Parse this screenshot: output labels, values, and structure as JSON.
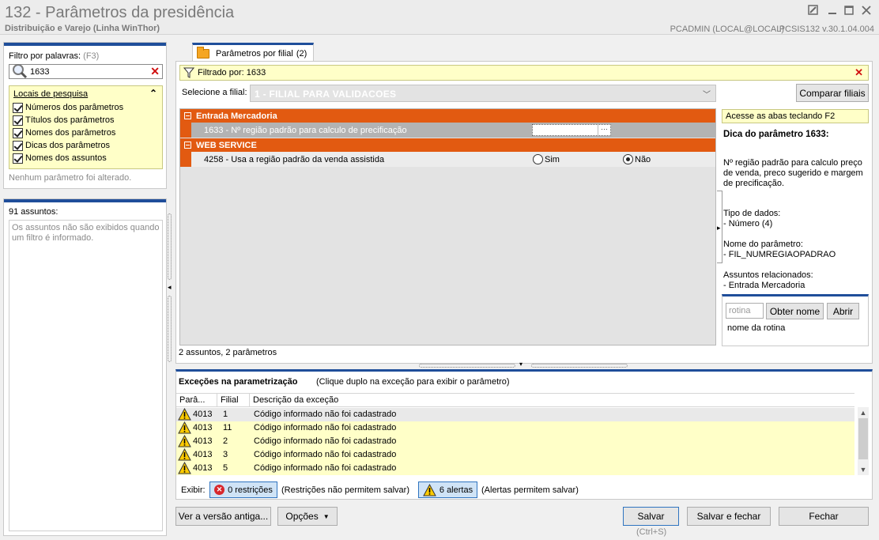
{
  "window": {
    "title": "132 - Parâmetros da presidência",
    "subtitle": "Distribuição e Varejo (Linha WinThor)",
    "user": "PCADMIN (LOCAL@LOCAL)",
    "version": "PCSIS132  v.30.1.04.004"
  },
  "filter": {
    "label": "Filtro por palavras:",
    "shortcut": "(F3)",
    "value": "1633",
    "locais_title": "Locais de pesquisa",
    "locais": [
      {
        "label": "Números dos parâmetros",
        "checked": true
      },
      {
        "label": "Títulos dos parâmetros",
        "checked": true
      },
      {
        "label": "Nomes dos parâmetros",
        "checked": true
      },
      {
        "label": "Dicas dos parâmetros",
        "checked": true
      },
      {
        "label": "Nomes dos assuntos",
        "checked": true
      }
    ],
    "no_change": "Nenhum parâmetro foi alterado."
  },
  "subjects": {
    "count": "91 assuntos:",
    "info": "Os assuntos não são exibidos quando um filtro é informado."
  },
  "tab": {
    "label": "Parâmetros por filial",
    "count": "(2)"
  },
  "filtered": {
    "text": "Filtrado por: 1633"
  },
  "branch": {
    "label": "Selecione a filial:",
    "selected": "1 - FILIAL PARA VALIDACOES",
    "compare_label": "Comparar filiais"
  },
  "groups": [
    {
      "name": "Entrada Mercadoria",
      "params": [
        {
          "text": "1633 - Nº região padrão para calculo de precificação",
          "value": ""
        }
      ]
    },
    {
      "name": "WEB SERVICE",
      "params": [
        {
          "text": "4258 - Usa a região padrão da venda assistida",
          "option_yes": "Sim",
          "option_no": "Não",
          "selected": "Não"
        }
      ]
    }
  ],
  "grid_summary": "2 assuntos, 2 parâmetros",
  "tip": {
    "hint": "Acesse as abas teclando F2",
    "title": "Dica do parâmetro 1633:",
    "description": "Nº região padrão para calculo preço de venda, preco sugerido e margem de precificação.",
    "data_type_label": "Tipo de dados:",
    "data_type": " - Número (4)",
    "param_name_label": "Nome do parâmetro:",
    "param_name": " - FIL_NUMREGIAOPADRAO",
    "subjects_label": "Assuntos relacionados:",
    "subjects_value": " - Entrada Mercadoria"
  },
  "rotina": {
    "placeholder": "rotina",
    "get_name_label": "Obter nome",
    "open_label": "Abrir",
    "name_text": "nome da rotina"
  },
  "exceptions": {
    "title": "Exceções na parametrização",
    "hint": "(Clique duplo na exceção para exibir o parâmetro)",
    "columns": [
      "Parâ...",
      "Filial",
      "Descrição da exceção"
    ],
    "rows": [
      {
        "param": "4013",
        "filial": "1",
        "desc": "Código informado não foi cadastrado"
      },
      {
        "param": "4013",
        "filial": "11",
        "desc": "Código informado não foi cadastrado"
      },
      {
        "param": "4013",
        "filial": "2",
        "desc": "Código informado não foi cadastrado"
      },
      {
        "param": "4013",
        "filial": "3",
        "desc": "Código informado não foi cadastrado"
      },
      {
        "param": "4013",
        "filial": "5",
        "desc": "Código informado não foi cadastrado"
      }
    ],
    "show_label": "Exibir:",
    "restrictions_label": "0 restrições",
    "restrictions_desc": "(Restrições não permitem salvar)",
    "alerts_label": "6 alertas",
    "alerts_desc": "(Alertas permitem salvar)"
  },
  "footer": {
    "old_version_label": "Ver a versão antiga...",
    "options_label": "Opções",
    "save_label": "Salvar",
    "save_shortcut": "(Ctrl+S)",
    "save_close_label": "Salvar e fechar",
    "close_label": "Fechar"
  },
  "colors": {
    "accent_blue": "#1f4e9a",
    "group_orange": "#e25a11",
    "highlight_yellow": "#ffffc8",
    "error_red": "#d01010"
  }
}
